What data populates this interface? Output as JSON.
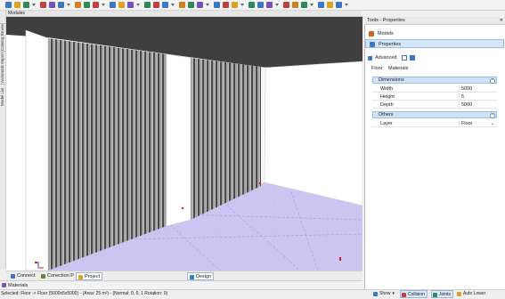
{
  "toolbar": {
    "icons": [
      "new-icon",
      "open-icon",
      "save-icon",
      "undo-icon",
      "redo-icon",
      "cut-icon",
      "copy-icon",
      "paste-icon",
      "select-icon",
      "move-icon",
      "rotate-icon",
      "scale-icon",
      "paint-icon",
      "light-icon",
      "camera-icon",
      "render-icon",
      "measure-icon",
      "grid-icon",
      "snap-icon",
      "view-icon",
      "wall-icon",
      "door-icon",
      "window-icon",
      "floor-icon",
      "roof-icon",
      "stair-icon",
      "furniture-icon",
      "export-icon",
      "settings-icon",
      "help-icon"
    ],
    "colors": [
      "#3c78c8",
      "#e0a020",
      "#2e8b57",
      "#c04040",
      "#7a4fc0",
      "#3c78c8",
      "#d08020",
      "#2e8b57",
      "#c04040",
      "#3c78c8",
      "#e0a020",
      "#7a4fc0",
      "#2e8b57",
      "#c04040",
      "#3c78c8",
      "#d08020",
      "#2e8b57",
      "#7a4fc0",
      "#3c78c8",
      "#c04040",
      "#e0a020",
      "#2e8b57",
      "#3c78c8",
      "#7a4fc0",
      "#c04040",
      "#d08020",
      "#2e8b57",
      "#3c78c8",
      "#e0a020",
      "#3c78c8"
    ]
  },
  "left_strip": {
    "tabs": [
      "Catalog Browser",
      "Automatic Import",
      "Model List"
    ]
  },
  "viewport": {
    "header_label": "Modules"
  },
  "bottom_tabs": {
    "connect": "Connect",
    "connection_p": "Conection P",
    "project": "Project",
    "design": "Design"
  },
  "materials_label": "Materials",
  "status": {
    "text": "Selected: Floor -> Floor (5000x5x5000) - (Area: 25 m²) - (Normal: 0, 0, 1 Rotation: 0)",
    "show": "Show",
    "collision": "Collision",
    "joints": "Joints",
    "auto_lower": "Auto Lower"
  },
  "panel": {
    "title": "Tools - Properties",
    "models": "Models",
    "properties": "Properties",
    "advanced": "Advanced",
    "tabs": [
      "Floor",
      "Materials"
    ],
    "dimensions_section": "Dimensions",
    "rows": [
      {
        "label": "Width",
        "value": "5000"
      },
      {
        "label": "Height",
        "value": "5"
      },
      {
        "label": "Depth",
        "value": "5000"
      }
    ],
    "others_section": "Others",
    "layer": {
      "label": "Layer",
      "value": "Floor"
    }
  }
}
